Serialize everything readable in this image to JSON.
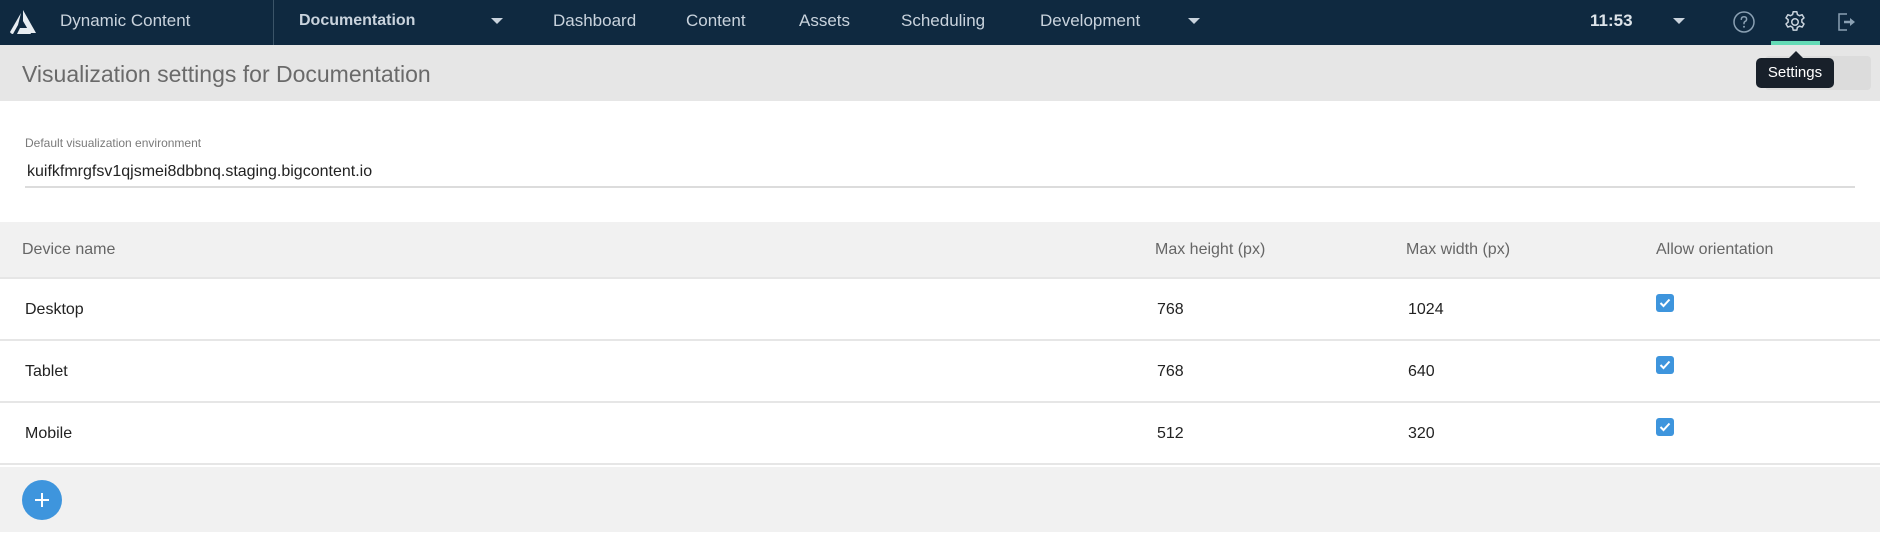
{
  "navbar": {
    "app_name": "Dynamic Content",
    "hub_selector": "Documentation",
    "items": [
      {
        "label": "Dashboard"
      },
      {
        "label": "Content"
      },
      {
        "label": "Assets"
      },
      {
        "label": "Scheduling"
      },
      {
        "label": "Development"
      }
    ],
    "clock": "11:53",
    "icons": [
      "help-icon",
      "settings-icon",
      "logout-icon"
    ],
    "active_icon": "settings-icon",
    "accent_color": "#64dbb6"
  },
  "tooltip": {
    "text": "Settings"
  },
  "page": {
    "title": "Visualization settings for Documentation"
  },
  "form": {
    "env_label": "Default visualization environment",
    "env_value": "kuifkfmrgfsv1qjsmei8dbbnq.staging.bigcontent.io"
  },
  "table": {
    "headers": [
      "Device name",
      "Max height (px)",
      "Max width (px)",
      "Allow orientation"
    ],
    "rows": [
      {
        "device": "Desktop",
        "max_height": "768",
        "max_width": "1024",
        "allow_orientation": true
      },
      {
        "device": "Tablet",
        "max_height": "768",
        "max_width": "640",
        "allow_orientation": true
      },
      {
        "device": "Mobile",
        "max_height": "512",
        "max_width": "320",
        "allow_orientation": true
      }
    ],
    "add_button_icon": "plus-icon",
    "checkbox_color": "#3e95dd"
  }
}
